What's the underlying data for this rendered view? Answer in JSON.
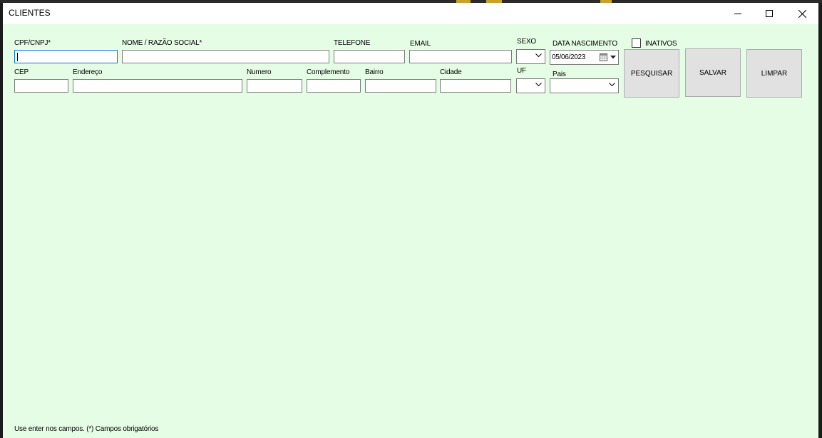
{
  "window": {
    "title": "CLIENTES",
    "minimize_icon": "minimize-icon",
    "maximize_icon": "maximize-icon",
    "close_icon": "close-icon"
  },
  "form": {
    "cpf_label": "CPF/CNPJ*",
    "cpf_value": "",
    "nome_label": "NOME / RAZÃO SOCIAL*",
    "nome_value": "",
    "telefone_label": "TELEFONE",
    "telefone_value": "",
    "email_label": "EMAIL",
    "email_value": "",
    "sexo_label": "SEXO",
    "sexo_value": "",
    "data_nascimento_label": "DATA NASCIMENTO",
    "data_nascimento_value": "05/06/2023",
    "inativos_label": "INATIVOS",
    "inativos_checked": false,
    "cep_label": "CEP",
    "cep_value": "",
    "endereco_label": "Endereço",
    "endereco_value": "",
    "numero_label": "Numero",
    "numero_value": "",
    "complemento_label": "Complemento",
    "complemento_value": "",
    "bairro_label": "Bairro",
    "bairro_value": "",
    "cidade_label": "Cidade",
    "cidade_value": "",
    "uf_label": "UF",
    "uf_value": "",
    "pais_label": "Pais",
    "pais_value": ""
  },
  "buttons": {
    "pesquisar": "PESQUISAR",
    "salvar": "SALVAR",
    "limpar": "LIMPAR"
  },
  "footer": {
    "note": "Use enter nos campos. (*) Campos obrigatórios"
  },
  "colors": {
    "form_background": "#e5fde5",
    "titlebar": "#ffffff",
    "focus_border": "#0078d7",
    "button_face": "#e1e1e1"
  }
}
